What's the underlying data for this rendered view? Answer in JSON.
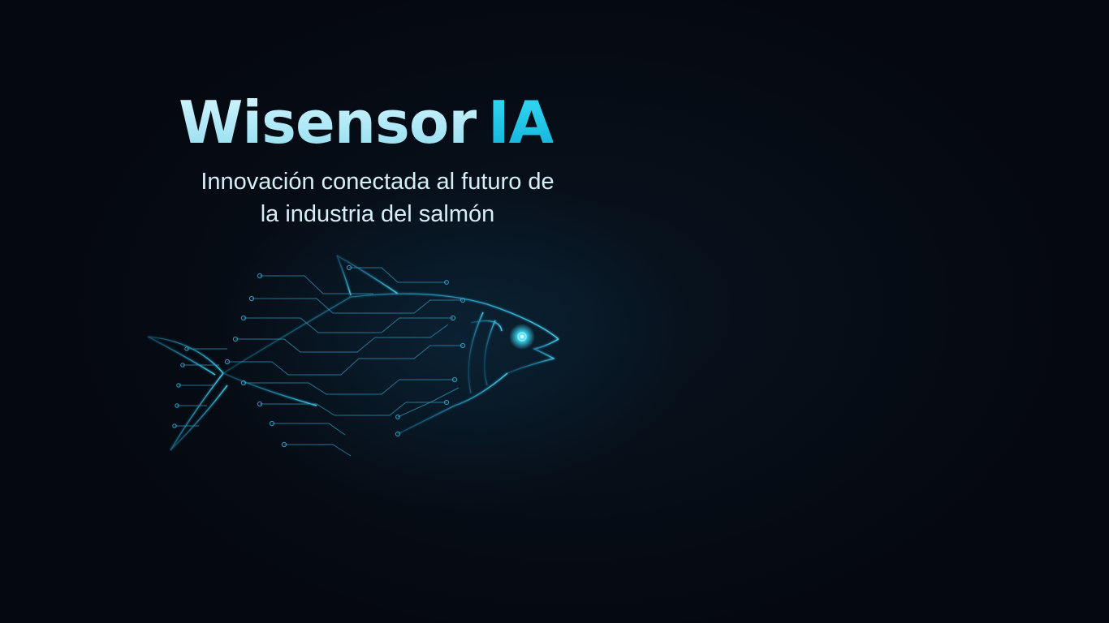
{
  "hero": {
    "title_brand": "Wisensor",
    "title_accent": "IA",
    "tagline_line1": "Innovación conectada al futuro de",
    "tagline_line2": "la industria del salmón"
  },
  "illustration": {
    "icon": "circuit-fish-icon"
  },
  "colors": {
    "background": "#05080f",
    "brand_light": "#b8eef8",
    "accent_cyan": "#1cc3e6",
    "circuit_line": "#2a8fb0",
    "eye_glow": "#3fe3ff"
  }
}
